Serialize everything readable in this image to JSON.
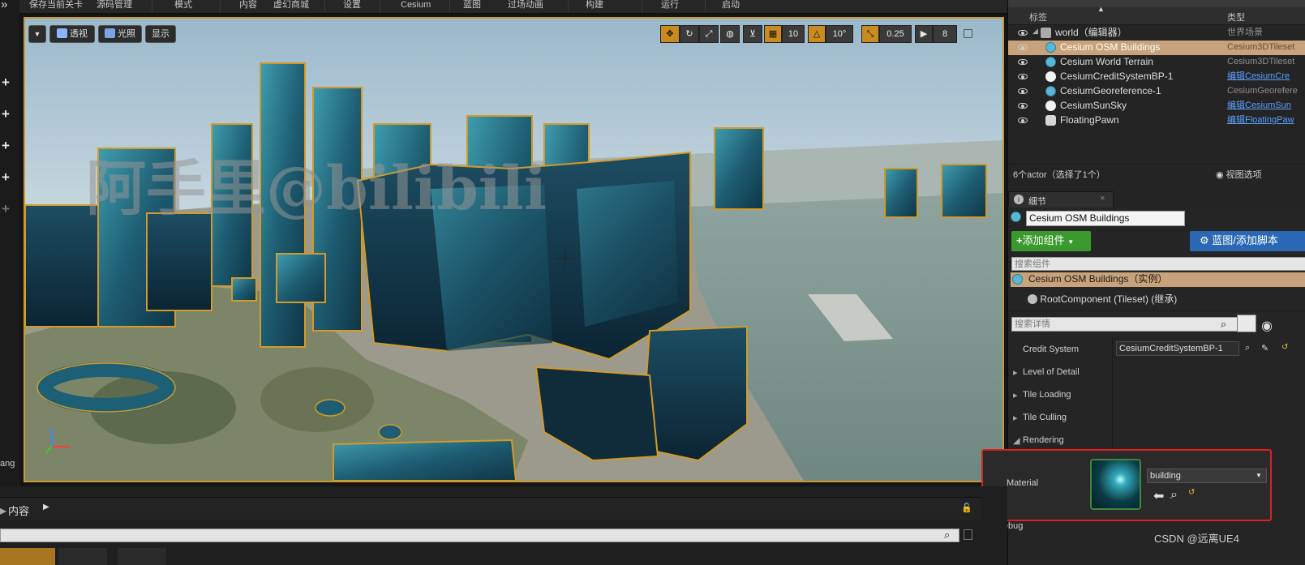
{
  "top_menu": {
    "items": [
      "保存当前关卡",
      "源码管理",
      "模式",
      "内容",
      "虚幻商城",
      "设置",
      "Cesium",
      "蓝图",
      "过场动画",
      "构建",
      "运行",
      "启动"
    ]
  },
  "viewport": {
    "view_mode": "透视",
    "lighting": "光照",
    "show": "显示",
    "grid_snap": "10",
    "rotation_snap": "10°",
    "scale_snap": "0.25",
    "camera_speed": "8",
    "watermark": "阿手里@bilibili"
  },
  "left_strip": {
    "bottom_text": "ang"
  },
  "outliner": {
    "col_label": "标签",
    "col_type": "类型",
    "rows": [
      {
        "name": "world（编辑器）",
        "type": "世界场景",
        "selected": false,
        "icon": "world-icon",
        "link": false
      },
      {
        "name": "Cesium OSM Buildings",
        "type": "Cesium3DTileset",
        "selected": true,
        "icon": "tileset-icon",
        "link": false
      },
      {
        "name": "Cesium World Terrain",
        "type": "Cesium3DTileset",
        "selected": false,
        "icon": "tileset-icon",
        "link": false
      },
      {
        "name": "CesiumCreditSystemBP-1",
        "type": "编辑CesiumCre",
        "selected": false,
        "icon": "actor-icon",
        "link": true
      },
      {
        "name": "CesiumGeoreference-1",
        "type": "CesiumGeorefere",
        "selected": false,
        "icon": "tileset-icon",
        "link": false
      },
      {
        "name": "CesiumSunSky",
        "type": "编辑CesiumSun",
        "selected": false,
        "icon": "actor-icon",
        "link": true
      },
      {
        "name": "FloatingPawn",
        "type": "编辑FloatingPaw",
        "selected": false,
        "icon": "pawn-icon",
        "link": true
      }
    ],
    "actor_count": "6个actor（选择了1个）",
    "view_options": "视图选项"
  },
  "details": {
    "tab": "细节",
    "actor_name": "Cesium OSM Buildings",
    "add_component": "添加组件",
    "blueprint_button": "蓝图/添加脚本",
    "search_components_placeholder": "搜索组件",
    "instance_row": "Cesium OSM Buildings（实例）",
    "root_component": "RootComponent (Tileset) (继承)",
    "search_details_placeholder": "搜索详情",
    "credit_system_label": "Credit System",
    "credit_system_value": "CesiumCreditSystemBP-1",
    "categories": [
      "Level of Detail",
      "Tile Loading",
      "Tile Culling",
      "Rendering"
    ],
    "material_label": "Material",
    "material_value": "building",
    "debug_label": "Debug",
    "highlight_color": "#e0201c"
  },
  "content_browser": {
    "tab": "内容"
  },
  "footer_credit": "CSDN @远离UE4",
  "colors": {
    "selection": "#c8a27a",
    "accent": "#c98a1f",
    "green": "#3a9a2d",
    "blue": "#2a67b5"
  }
}
